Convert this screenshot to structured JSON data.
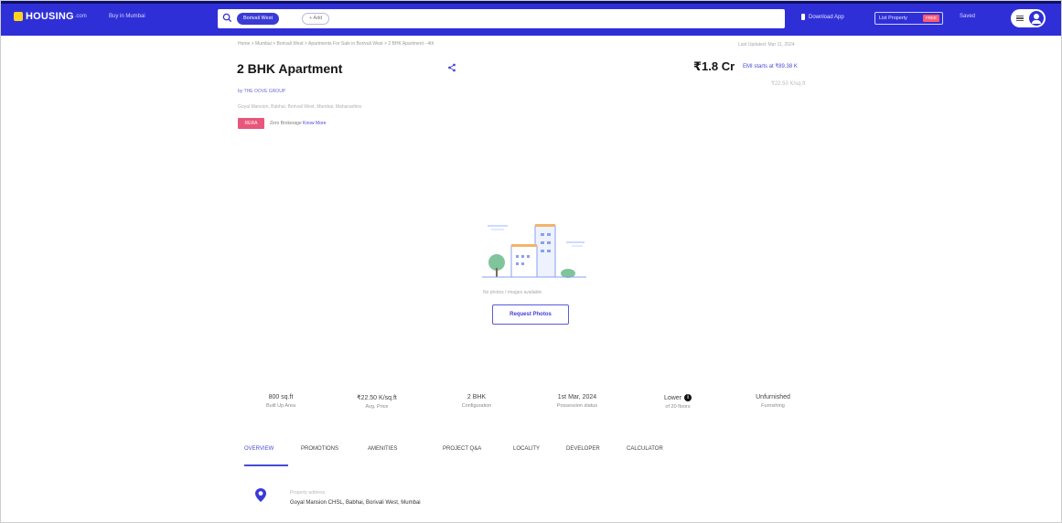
{
  "nav": {
    "logo_text": "HOUSING",
    "logo_sub": ".com",
    "city": "Buy in Mumbai",
    "search_chip": "Borivali West",
    "more_chip": "+ Add",
    "download_app": "Download App",
    "list_property": "List Property",
    "free_badge": "FREE",
    "saved": "Saved"
  },
  "header": {
    "breadcrumb": "Home > Mumbai > Borivali West > Apartments For Sale in Borivali West > 2 BHK Apartment - 4th",
    "updated": "Last Updated: Mar 11, 2024",
    "title": "2 BHK Apartment",
    "price": "₹1.8 Cr",
    "emi": "EMI starts at ₹89.38 K",
    "price_sub": "₹22.50 K/sq.ft",
    "developer": "by THE OOVE GROUP",
    "address": "Goyal Mansion, Babhai, Borivali West, Mumbai, Maharashtra",
    "rera_badge": "RERA",
    "zero_brokerage": "Zero Brokerage",
    "zero_brokerage_link": "Know More"
  },
  "placeholder": {
    "text": "No photos / images available",
    "button": "Request Photos"
  },
  "stats": [
    {
      "value": "800 sq.ft",
      "label": "Built Up Area"
    },
    {
      "value": "₹22.50 K/sq.ft",
      "label": "Avg. Price"
    },
    {
      "value": "2 BHK",
      "label": "Configuration"
    },
    {
      "value": "1st Mar, 2024",
      "label": "Possession status"
    },
    {
      "value": "Lower",
      "label": "of 20 floors"
    },
    {
      "value": "Unfurnished",
      "label": "Furnishing"
    }
  ],
  "tabs": [
    "OVERVIEW",
    "PROMOTIONS",
    "AMENITIES",
    "PROJECT Q&A",
    "LOCALITY",
    "DEVELOPER",
    "CALCULATOR"
  ],
  "location": {
    "label": "Property address",
    "value": "Goyal Mansion CHSL, Babhai, Borivali West, Mumbai"
  },
  "colors": {
    "brand": "#2f2fd8",
    "accent": "#4a4ad8",
    "badge": "#e9567b",
    "logo": "#ffd21f"
  }
}
